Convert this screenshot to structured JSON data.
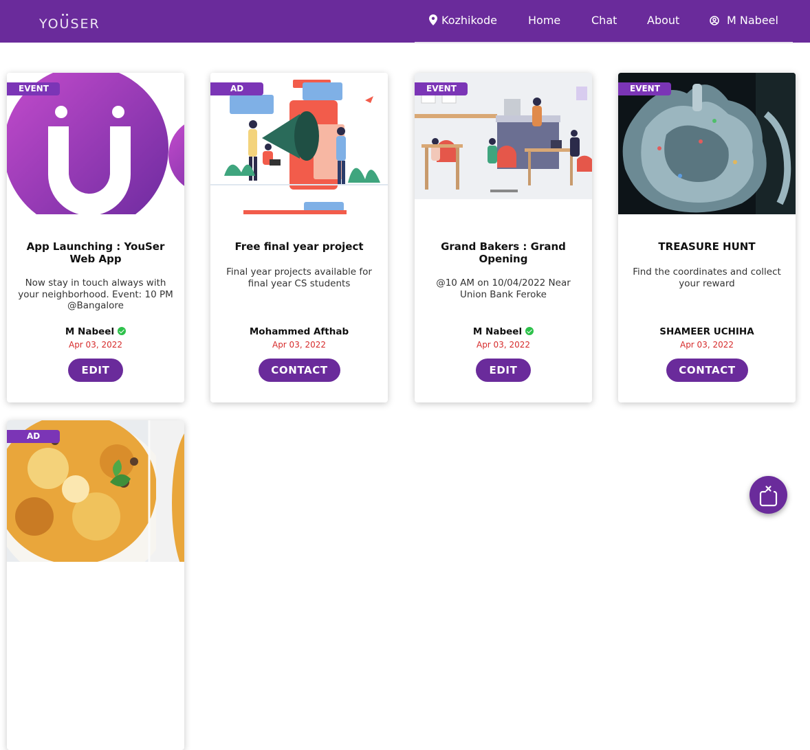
{
  "app": {
    "brand": "YOUSER"
  },
  "nav": {
    "location": "Kozhikode",
    "home": "Home",
    "chat": "Chat",
    "about": "About",
    "user": "M Nabeel"
  },
  "colors": {
    "primary": "#6a2b9b",
    "badge": "#7b35b6",
    "date": "#d62b2b",
    "verified": "#2ec14b"
  },
  "cards": [
    {
      "badge": "EVENT",
      "title": "App Launching : YouSer Web App",
      "description": "Now stay in touch always with your neighborhood. Event: 10 PM @Bangalore",
      "author": "M Nabeel",
      "verified": true,
      "date": "Apr 03, 2022",
      "button": "EDIT",
      "image_icon": "youser-logo-image"
    },
    {
      "badge": "AD",
      "title": "Free final year project",
      "description": "Final year projects available for final year CS students",
      "author": "Mohammed Afthab",
      "verified": false,
      "date": "Apr 03, 2022",
      "button": "CONTACT",
      "image_icon": "megaphone-illustration-image"
    },
    {
      "badge": "EVENT",
      "title": "Grand Bakers : Grand Opening",
      "description": "@10 AM on 10/04/2022 Near Union Bank Feroke",
      "author": "M Nabeel",
      "verified": true,
      "date": "Apr 03, 2022",
      "button": "EDIT",
      "image_icon": "cafe-illustration-image"
    },
    {
      "badge": "EVENT",
      "title": "TREASURE HUNT",
      "description": "Find the coordinates and collect your reward",
      "author": "SHAMEER UCHIHA",
      "verified": false,
      "date": "Apr 03, 2022",
      "button": "CONTACT",
      "image_icon": "treasure-map-image"
    },
    {
      "badge": "AD",
      "image_icon": "biryani-food-image"
    }
  ],
  "fab": {
    "icon": "close-panel-icon"
  }
}
